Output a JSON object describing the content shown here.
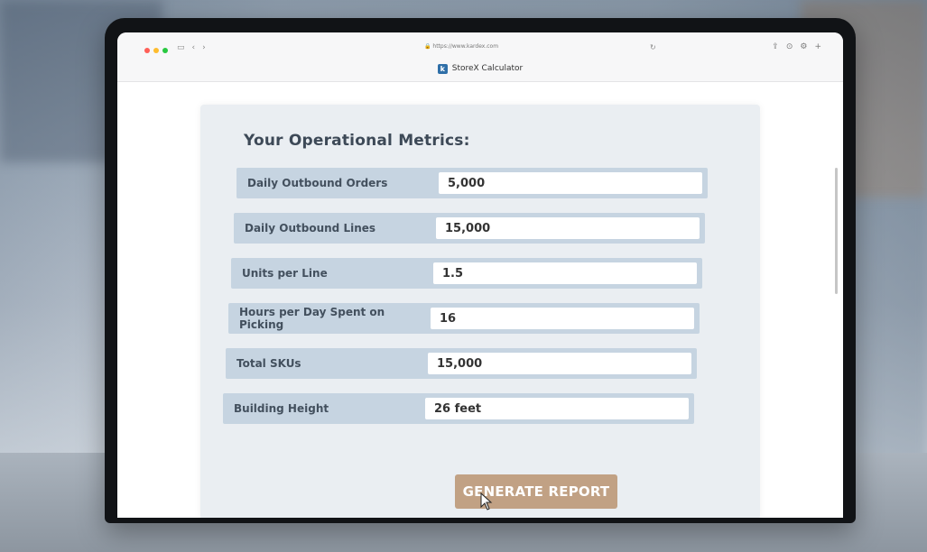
{
  "browser": {
    "url": "https://www.kardex.com",
    "tab_title": "StoreX Calculator",
    "favicon": "k"
  },
  "form": {
    "heading": "Your Operational Metrics:",
    "fields": [
      {
        "label": "Daily Outbound Orders",
        "value": "5,000"
      },
      {
        "label": "Daily Outbound Lines",
        "value": "15,000"
      },
      {
        "label": "Units per Line",
        "value": "1.5"
      },
      {
        "label": "Hours per Day Spent on Picking",
        "value": "16"
      },
      {
        "label": "Total SKUs",
        "value": "15,000"
      },
      {
        "label": "Building Height",
        "value": "26 feet"
      }
    ],
    "submit_label": "GENERATE REPORT"
  },
  "colors": {
    "button": "#c1a184",
    "row_bg": "#c6d4e1",
    "card_bg": "#eaeef2",
    "favicon_bg": "#2f6fa8"
  }
}
